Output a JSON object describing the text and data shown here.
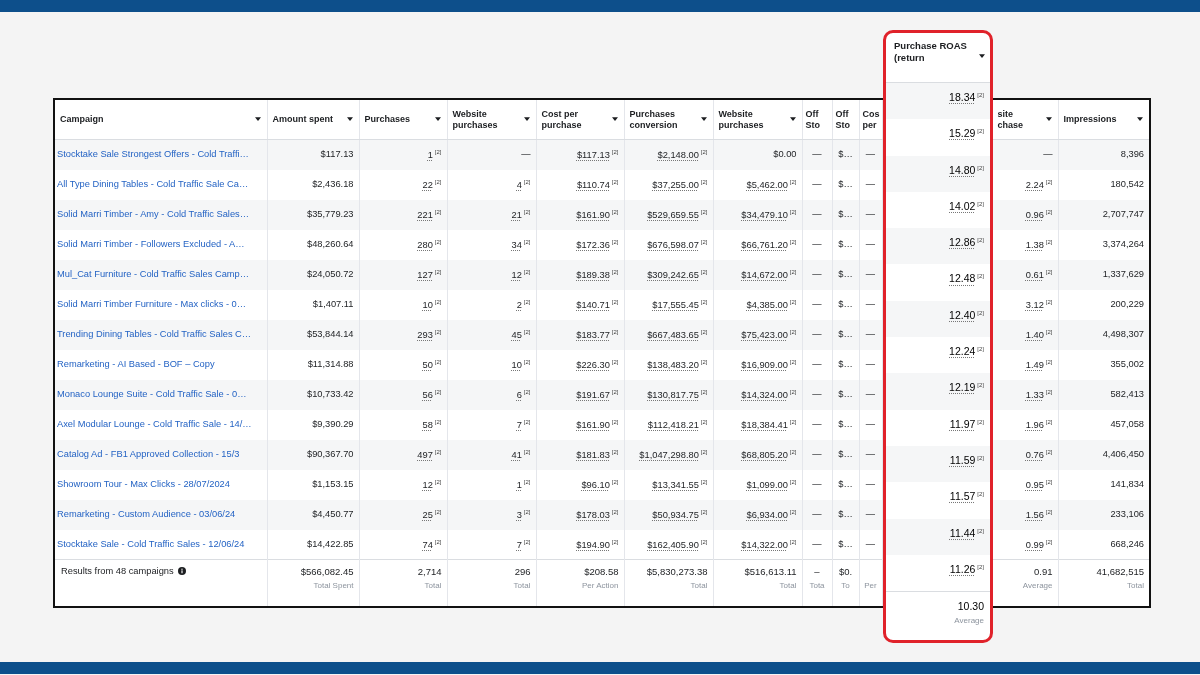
{
  "table": {
    "columns": [
      {
        "label": "Campaign",
        "kind": "text",
        "caret": true
      },
      {
        "label": "Amount spent",
        "kind": "number",
        "caret": true
      },
      {
        "label": "Purchases",
        "kind": "number",
        "caret": true
      },
      {
        "label": "Website purchases",
        "kind": "number",
        "caret": true
      },
      {
        "label": "Cost per purchase",
        "kind": "number",
        "caret": true
      },
      {
        "label": "Purchases conversion",
        "kind": "number",
        "caret": true
      },
      {
        "label": "Website purchases",
        "kind": "number",
        "caret": true
      },
      {
        "label": "Off Sto",
        "kind": "narrow",
        "caret": false
      },
      {
        "label": "Off Sto",
        "kind": "narrow",
        "caret": false
      },
      {
        "label": "Cos per",
        "kind": "narrow",
        "caret": false
      },
      {
        "label": "site chase",
        "kind": "number",
        "caret": true
      },
      {
        "label": "Impressions",
        "kind": "number",
        "caret": true
      }
    ],
    "rows": [
      {
        "cells": [
          {
            "value": "Stocktake Sale Strongest Offers - Cold Traffi…"
          },
          {
            "value": "$117.13"
          },
          {
            "value": "1",
            "note": "[2]"
          },
          {
            "value": "—"
          },
          {
            "value": "$117.13",
            "note": "[2]"
          },
          {
            "value": "$2,148.00",
            "note": "[2]"
          },
          {
            "value": "$0.00"
          },
          {
            "value": "—"
          },
          {
            "value": "$…"
          },
          {
            "value": "—"
          },
          {
            "value": "—"
          },
          {
            "value": "8,396"
          }
        ]
      },
      {
        "cells": [
          {
            "value": "All Type Dining Tables - Cold Traffic Sale Ca…"
          },
          {
            "value": "$2,436.18"
          },
          {
            "value": "22",
            "note": "[2]"
          },
          {
            "value": "4",
            "note": "[2]"
          },
          {
            "value": "$110.74",
            "note": "[2]"
          },
          {
            "value": "$37,255.00",
            "note": "[2]"
          },
          {
            "value": "$5,462.00",
            "note": "[2]"
          },
          {
            "value": "—"
          },
          {
            "value": "$…"
          },
          {
            "value": "—"
          },
          {
            "value": "2.24",
            "note": "[2]"
          },
          {
            "value": "180,542"
          }
        ]
      },
      {
        "cells": [
          {
            "value": "Solid Marri Timber - Amy - Cold Traffic Sales…"
          },
          {
            "value": "$35,779.23"
          },
          {
            "value": "221",
            "note": "[2]"
          },
          {
            "value": "21",
            "note": "[2]"
          },
          {
            "value": "$161.90",
            "note": "[2]"
          },
          {
            "value": "$529,659.55",
            "note": "[2]"
          },
          {
            "value": "$34,479.10",
            "note": "[2]"
          },
          {
            "value": "—"
          },
          {
            "value": "$…"
          },
          {
            "value": "—"
          },
          {
            "value": "0.96",
            "note": "[2]"
          },
          {
            "value": "2,707,747"
          }
        ]
      },
      {
        "cells": [
          {
            "value": "Solid Marri Timber - Followers Excluded - A…"
          },
          {
            "value": "$48,260.64"
          },
          {
            "value": "280",
            "note": "[2]"
          },
          {
            "value": "34",
            "note": "[2]"
          },
          {
            "value": "$172.36",
            "note": "[2]"
          },
          {
            "value": "$676,598.07",
            "note": "[2]"
          },
          {
            "value": "$66,761.20",
            "note": "[2]"
          },
          {
            "value": "—"
          },
          {
            "value": "$…"
          },
          {
            "value": "—"
          },
          {
            "value": "1.38",
            "note": "[2]"
          },
          {
            "value": "3,374,264"
          }
        ]
      },
      {
        "cells": [
          {
            "value": "Mul_Cat Furniture - Cold Traffic Sales Camp…"
          },
          {
            "value": "$24,050.72"
          },
          {
            "value": "127",
            "note": "[2]"
          },
          {
            "value": "12",
            "note": "[2]"
          },
          {
            "value": "$189.38",
            "note": "[2]"
          },
          {
            "value": "$309,242.65",
            "note": "[2]"
          },
          {
            "value": "$14,672.00",
            "note": "[2]"
          },
          {
            "value": "—"
          },
          {
            "value": "$…"
          },
          {
            "value": "—"
          },
          {
            "value": "0.61",
            "note": "[2]"
          },
          {
            "value": "1,337,629"
          }
        ]
      },
      {
        "cells": [
          {
            "value": "Solid Marri Timber Furniture - Max clicks - 0…"
          },
          {
            "value": "$1,407.11"
          },
          {
            "value": "10",
            "note": "[2]"
          },
          {
            "value": "2",
            "note": "[2]"
          },
          {
            "value": "$140.71",
            "note": "[2]"
          },
          {
            "value": "$17,555.45",
            "note": "[2]"
          },
          {
            "value": "$4,385.00",
            "note": "[2]"
          },
          {
            "value": "—"
          },
          {
            "value": "$…"
          },
          {
            "value": "—"
          },
          {
            "value": "3.12",
            "note": "[2]"
          },
          {
            "value": "200,229"
          }
        ]
      },
      {
        "cells": [
          {
            "value": "Trending Dining Tables - Cold Traffic Sales C…"
          },
          {
            "value": "$53,844.14"
          },
          {
            "value": "293",
            "note": "[2]"
          },
          {
            "value": "45",
            "note": "[2]"
          },
          {
            "value": "$183.77",
            "note": "[2]"
          },
          {
            "value": "$667,483.65",
            "note": "[2]"
          },
          {
            "value": "$75,423.00",
            "note": "[2]"
          },
          {
            "value": "—"
          },
          {
            "value": "$…"
          },
          {
            "value": "—"
          },
          {
            "value": "1.40",
            "note": "[2]"
          },
          {
            "value": "4,498,307"
          }
        ]
      },
      {
        "cells": [
          {
            "value": "Remarketing - AI Based - BOF – Copy"
          },
          {
            "value": "$11,314.88"
          },
          {
            "value": "50",
            "note": "[2]"
          },
          {
            "value": "10",
            "note": "[2]"
          },
          {
            "value": "$226.30",
            "note": "[2]"
          },
          {
            "value": "$138,483.20",
            "note": "[2]"
          },
          {
            "value": "$16,909.00",
            "note": "[2]"
          },
          {
            "value": "—"
          },
          {
            "value": "$…"
          },
          {
            "value": "—"
          },
          {
            "value": "1.49",
            "note": "[2]"
          },
          {
            "value": "355,002"
          }
        ]
      },
      {
        "cells": [
          {
            "value": "Monaco Lounge Suite - Cold Traffic Sale - 0…"
          },
          {
            "value": "$10,733.42"
          },
          {
            "value": "56",
            "note": "[2]"
          },
          {
            "value": "6",
            "note": "[2]"
          },
          {
            "value": "$191.67",
            "note": "[2]"
          },
          {
            "value": "$130,817.75",
            "note": "[2]"
          },
          {
            "value": "$14,324.00",
            "note": "[2]"
          },
          {
            "value": "—"
          },
          {
            "value": "$…"
          },
          {
            "value": "—"
          },
          {
            "value": "1.33",
            "note": "[2]"
          },
          {
            "value": "582,413"
          }
        ]
      },
      {
        "cells": [
          {
            "value": "Axel Modular Lounge - Cold Traffic Sale - 14/…"
          },
          {
            "value": "$9,390.29"
          },
          {
            "value": "58",
            "note": "[2]"
          },
          {
            "value": "7",
            "note": "[2]"
          },
          {
            "value": "$161.90",
            "note": "[2]"
          },
          {
            "value": "$112,418.21",
            "note": "[2]"
          },
          {
            "value": "$18,384.41",
            "note": "[2]"
          },
          {
            "value": "—"
          },
          {
            "value": "$…"
          },
          {
            "value": "—"
          },
          {
            "value": "1.96",
            "note": "[2]"
          },
          {
            "value": "457,058"
          }
        ]
      },
      {
        "cells": [
          {
            "value": "Catalog Ad - FB1 Approved Collection - 15/3"
          },
          {
            "value": "$90,367.70"
          },
          {
            "value": "497",
            "note": "[2]"
          },
          {
            "value": "41",
            "note": "[2]"
          },
          {
            "value": "$181.83",
            "note": "[2]"
          },
          {
            "value": "$1,047,298.80",
            "note": "[2]"
          },
          {
            "value": "$68,805.20",
            "note": "[2]"
          },
          {
            "value": "—"
          },
          {
            "value": "$…"
          },
          {
            "value": "—"
          },
          {
            "value": "0.76",
            "note": "[2]"
          },
          {
            "value": "4,406,450"
          }
        ]
      },
      {
        "cells": [
          {
            "value": "Showroom Tour - Max Clicks - 28/07/2024"
          },
          {
            "value": "$1,153.15"
          },
          {
            "value": "12",
            "note": "[2]"
          },
          {
            "value": "1",
            "note": "[2]"
          },
          {
            "value": "$96.10",
            "note": "[2]"
          },
          {
            "value": "$13,341.55",
            "note": "[2]"
          },
          {
            "value": "$1,099.00",
            "note": "[2]"
          },
          {
            "value": "—"
          },
          {
            "value": "$…"
          },
          {
            "value": "—"
          },
          {
            "value": "0.95",
            "note": "[2]"
          },
          {
            "value": "141,834"
          }
        ]
      },
      {
        "cells": [
          {
            "value": "Remarketing - Custom Audience - 03/06/24"
          },
          {
            "value": "$4,450.77"
          },
          {
            "value": "25",
            "note": "[2]"
          },
          {
            "value": "3",
            "note": "[2]"
          },
          {
            "value": "$178.03",
            "note": "[2]"
          },
          {
            "value": "$50,934.75",
            "note": "[2]"
          },
          {
            "value": "$6,934.00",
            "note": "[2]"
          },
          {
            "value": "—"
          },
          {
            "value": "$…"
          },
          {
            "value": "—"
          },
          {
            "value": "1.56",
            "note": "[2]"
          },
          {
            "value": "233,106"
          }
        ]
      },
      {
        "cells": [
          {
            "value": "Stocktake Sale - Cold Traffic Sales - 12/06/24"
          },
          {
            "value": "$14,422.85"
          },
          {
            "value": "74",
            "note": "[2]"
          },
          {
            "value": "7",
            "note": "[2]"
          },
          {
            "value": "$194.90",
            "note": "[2]"
          },
          {
            "value": "$162,405.90",
            "note": "[2]"
          },
          {
            "value": "$14,322.00",
            "note": "[2]"
          },
          {
            "value": "—"
          },
          {
            "value": "$…"
          },
          {
            "value": "—"
          },
          {
            "value": "0.99",
            "note": "[2]"
          },
          {
            "value": "668,246"
          }
        ]
      }
    ],
    "footer": {
      "cells": [
        {
          "value": "Results from 48 campaigns"
        },
        {
          "value": "$566,082.45",
          "caption": "Total Spent"
        },
        {
          "value": "2,714",
          "caption": "Total"
        },
        {
          "value": "296",
          "caption": "Total"
        },
        {
          "value": "$208.58",
          "caption": "Per Action"
        },
        {
          "value": "$5,830,273.38",
          "caption": "Total"
        },
        {
          "value": "$516,613.11",
          "caption": "Total"
        },
        {
          "value": "–",
          "caption": "Tota"
        },
        {
          "value": "$0.",
          "caption": "To"
        },
        {
          "caption": "Per"
        },
        {
          "value": "0.91",
          "caption": "Average"
        },
        {
          "value": "41,682,515",
          "caption": "Total"
        }
      ]
    }
  },
  "highlight": {
    "column": {
      "label": "Purchase ROAS (return",
      "caret": true
    },
    "rows": [
      {
        "value": "18.34",
        "note": "[2]"
      },
      {
        "value": "15.29",
        "note": "[2]"
      },
      {
        "value": "14.80",
        "note": "[2]"
      },
      {
        "value": "14.02",
        "note": "[2]"
      },
      {
        "value": "12.86",
        "note": "[2]"
      },
      {
        "value": "12.48",
        "note": "[2]"
      },
      {
        "value": "12.40",
        "note": "[2]"
      },
      {
        "value": "12.24",
        "note": "[2]"
      },
      {
        "value": "12.19",
        "note": "[2]"
      },
      {
        "value": "11.97",
        "note": "[2]"
      },
      {
        "value": "11.59",
        "note": "[2]"
      },
      {
        "value": "11.57",
        "note": "[2]"
      },
      {
        "value": "11.44",
        "note": "[2]"
      },
      {
        "value": "11.26",
        "note": "[2]"
      }
    ],
    "footer": {
      "value": "10.30",
      "caption": "Average"
    }
  }
}
